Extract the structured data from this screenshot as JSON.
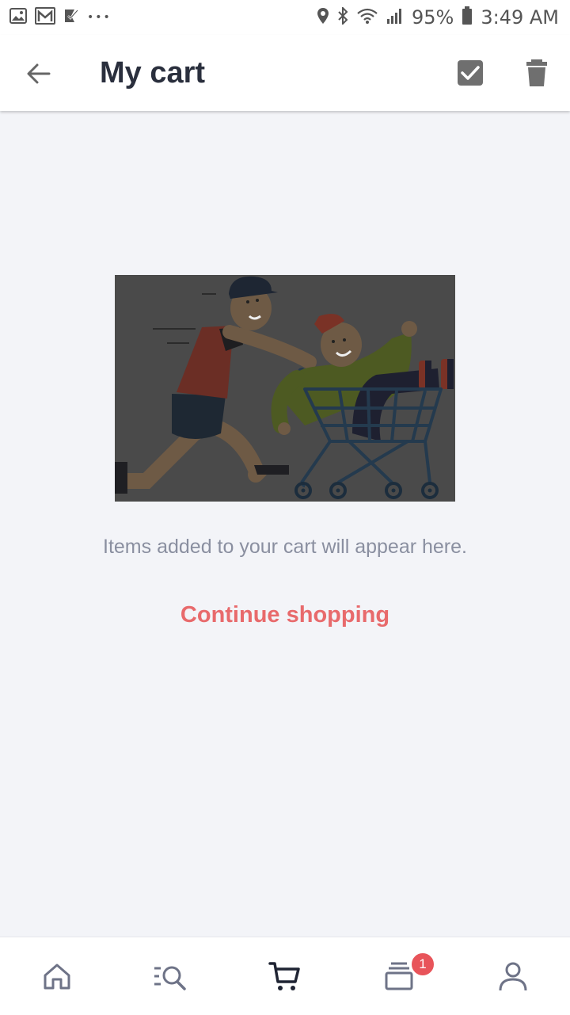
{
  "status_bar": {
    "battery_text": "95%",
    "time": "3:49 AM",
    "overflow_dots": "•••"
  },
  "header": {
    "title": "My cart"
  },
  "main": {
    "empty_message": "Items added to your cart will appear here.",
    "continue_label": "Continue shopping"
  },
  "bottom_nav": {
    "items": [
      {
        "icon": "home-icon"
      },
      {
        "icon": "search-icon"
      },
      {
        "icon": "cart-icon",
        "active": true
      },
      {
        "icon": "orders-icon",
        "badge": "1"
      },
      {
        "icon": "account-icon"
      }
    ]
  },
  "colors": {
    "accent": "#e86a6c",
    "title": "#2a2f3d",
    "background": "#f3f4f8",
    "badge": "#e8545a"
  }
}
